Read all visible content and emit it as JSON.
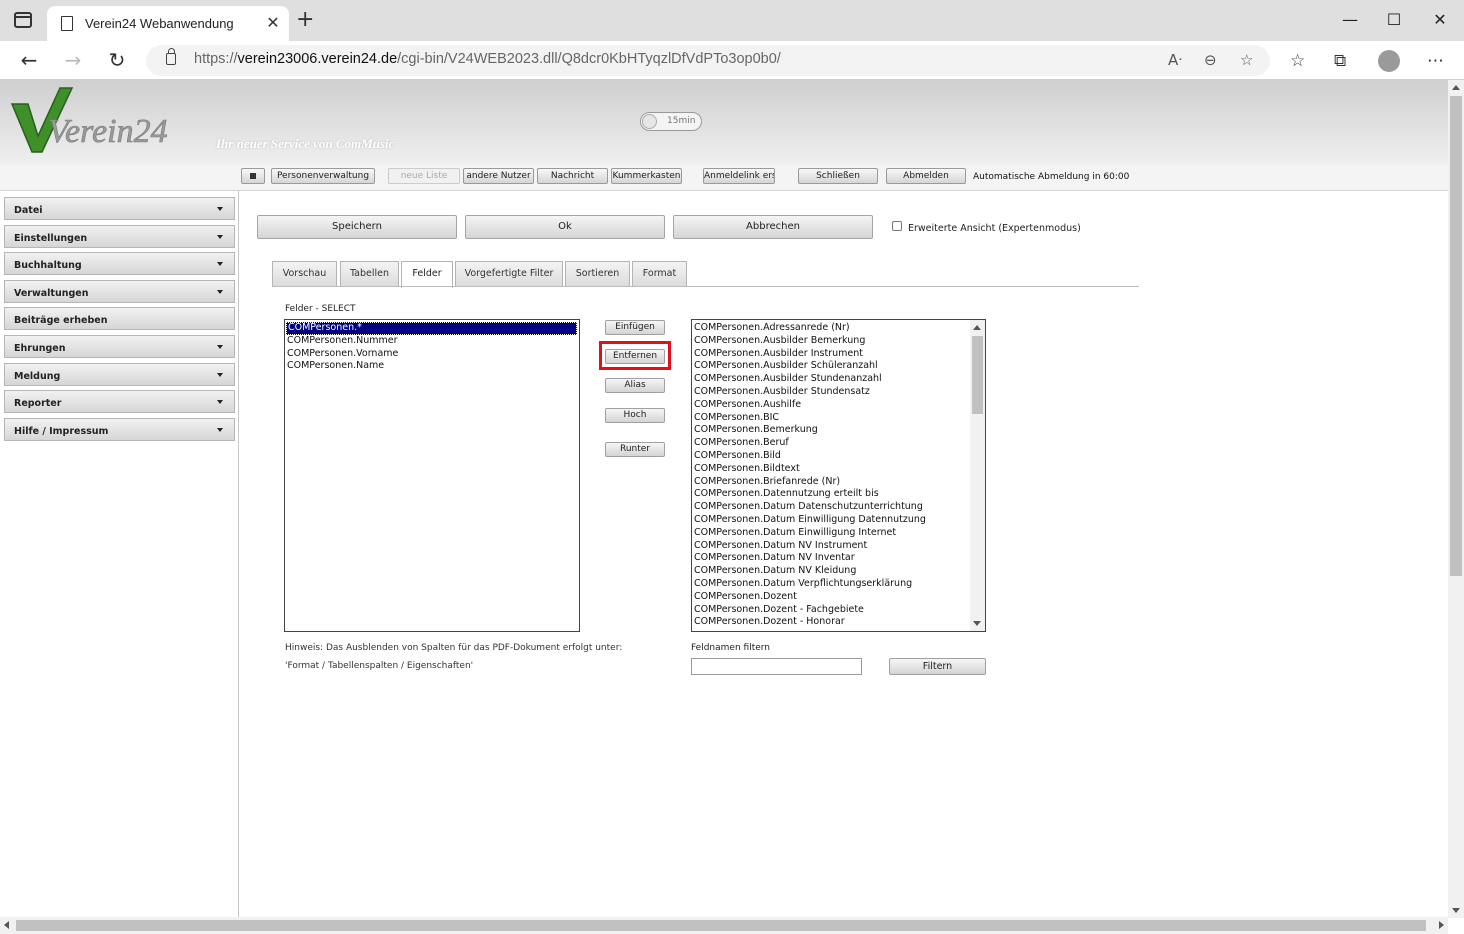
{
  "browser": {
    "tab_title": "Verein24 Webanwendung",
    "url_prefix": "https://",
    "url_host": "verein23006.verein24.de",
    "url_path": "/cgi-bin/V24WEB2023.dll/Q8dcr0KbHTyqzlDfVdPTo3op0b0/"
  },
  "header": {
    "logo_text": "Verein24",
    "slogan": "Ihr neuer Service von ComMusic",
    "timer_label": "15min"
  },
  "toolbar": {
    "buttons": [
      "Personenverwaltung",
      "neue Liste",
      "andere Nutzer",
      "Nachricht",
      "Kummerkasten",
      "Anmeldelink erst",
      "Schließen",
      "Abmelden"
    ],
    "status": "Automatische Abmeldung in 60:00"
  },
  "sidebar": {
    "items": [
      "Datei",
      "Einstellungen",
      "Buchhaltung",
      "Verwaltungen",
      "Beiträge erheben",
      "Ehrungen",
      "Meldung",
      "Reporter",
      "Hilfe / Impressum"
    ]
  },
  "actions": {
    "save": "Speichern",
    "ok": "Ok",
    "cancel": "Abbrechen",
    "expert_mode": "Erweiterte Ansicht (Expertenmodus)"
  },
  "tabs": [
    "Vorschau",
    "Tabellen",
    "Felder",
    "Vorgefertigte Filter",
    "Sortieren",
    "Format"
  ],
  "fields": {
    "label": "Felder - SELECT",
    "selected": [
      "COMPersonen.*",
      "COMPersonen.Nummer",
      "COMPersonen.Vorname",
      "COMPersonen.Name"
    ],
    "buttons": [
      "Einfügen",
      "Entfernen",
      "Alias",
      "Hoch",
      "Runter"
    ],
    "available": [
      "COMPersonen.Adressanrede (Nr)",
      "COMPersonen.Ausbilder Bemerkung",
      "COMPersonen.Ausbilder Instrument",
      "COMPersonen.Ausbilder Schüleranzahl",
      "COMPersonen.Ausbilder Stundenanzahl",
      "COMPersonen.Ausbilder Stundensatz",
      "COMPersonen.Aushilfe",
      "COMPersonen.BIC",
      "COMPersonen.Bemerkung",
      "COMPersonen.Beruf",
      "COMPersonen.Bild",
      "COMPersonen.Bildtext",
      "COMPersonen.Briefanrede (Nr)",
      "COMPersonen.Datennutzung erteilt bis",
      "COMPersonen.Datum Datenschutzunterrichtung",
      "COMPersonen.Datum Einwilligung Datennutzung",
      "COMPersonen.Datum Einwilligung Internet",
      "COMPersonen.Datum NV Instrument",
      "COMPersonen.Datum NV Inventar",
      "COMPersonen.Datum NV Kleidung",
      "COMPersonen.Datum Verpflichtungserklärung",
      "COMPersonen.Dozent",
      "COMPersonen.Dozent - Fachgebiete",
      "COMPersonen.Dozent - Honorar"
    ],
    "hint_line1": "Hinweis: Das Ausblenden von Spalten für das PDF-Dokument erfolgt unter:",
    "hint_line2": "'Format / Tabellenspalten / Eigenschaften'",
    "filter_label": "Feldnamen filtern",
    "filter_value": "",
    "filter_button": "Filtern"
  }
}
